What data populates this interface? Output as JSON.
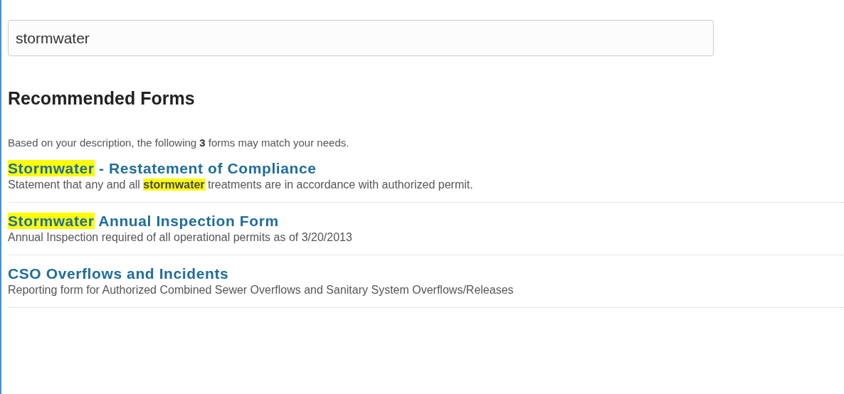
{
  "search": {
    "value": "stormwater"
  },
  "heading": "Recommended Forms",
  "intro": "Based on your description, the following **3** forms may match your needs.",
  "results": [
    {
      "title": [
        {
          "text": "Stormwater",
          "highlighted": true
        },
        {
          "text": " - Restatement of Compliance",
          "highlighted": false
        }
      ],
      "description": [
        {
          "text": "Statement that any and all ",
          "highlighted": false
        },
        {
          "text": "stormwater",
          "highlighted": true
        },
        {
          "text": " treatments are in accordance with authorized permit.",
          "highlighted": false
        }
      ]
    },
    {
      "title": [
        {
          "text": "Stormwater",
          "highlighted": true
        },
        {
          "text": " Annual Inspection Form",
          "highlighted": false
        }
      ],
      "description": [
        {
          "text": "Annual Inspection required of all operational permits as of 3/20/2013",
          "highlighted": false
        }
      ]
    },
    {
      "title": [
        {
          "text": "CSO Overflows and Incidents",
          "highlighted": false
        }
      ],
      "description": [
        {
          "text": "Reporting form for Authorized Combined Sewer Overflows and Sanitary System Overflows/Releases",
          "highlighted": false
        }
      ]
    }
  ]
}
